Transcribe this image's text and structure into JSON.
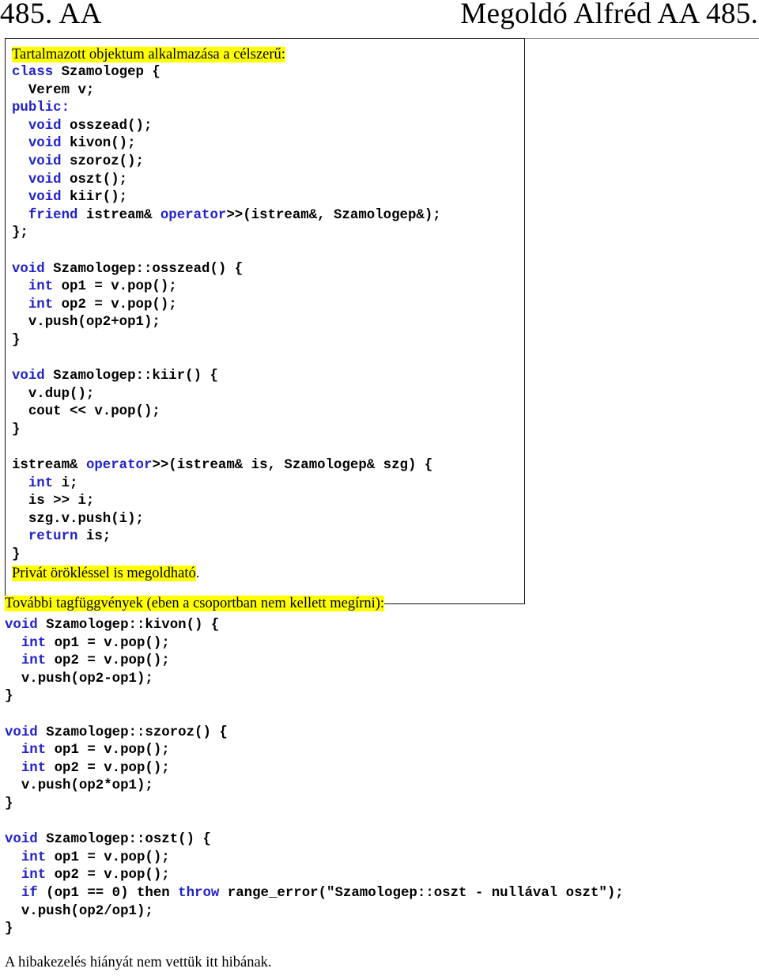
{
  "header": {
    "left_title": "485. AA",
    "right_title": "Megoldó Alfréd AA 485."
  },
  "table": {
    "main_cell": {
      "intro_note": "Tartalmazott objektum alkalmazása a célszerű:",
      "class_declaration": {
        "l1_kw": "class",
        "l1_rest": " Szamologep {",
        "l2": "  Verem v;",
        "l3_kw": "public:",
        "l4_kw": "  void",
        "l4_rest": " osszead();",
        "l5_kw": "  void",
        "l5_rest": " kivon();",
        "l6_kw": "  void",
        "l6_rest": " szoroz();",
        "l7_kw": "  void",
        "l7_rest": " oszt();",
        "l8_kw": "  void",
        "l8_rest": " kiir();",
        "l9_kw": "  friend",
        "l9_mid": " istream& ",
        "l9_kw2": "operator",
        "l9_rest": ">>(istream&, Szamologep&);",
        "l10": "};"
      },
      "osszead_def": {
        "l1_kw": "void",
        "l1_rest": " Szamologep::osszead() {",
        "l2_kw": "  int",
        "l2_rest": " op1 = v.pop();",
        "l3_kw": "  int",
        "l3_rest": " op2 = v.pop();",
        "l4": "  v.push(op2+op1);",
        "l5": "}"
      },
      "kiir_def": {
        "l1_kw": "void",
        "l1_rest": " Szamologep::kiir() {",
        "l2": "  v.dup();",
        "l3": "  cout << v.pop();",
        "l4": "}"
      },
      "operator_def": {
        "l1_pre": "istream& ",
        "l1_kw": "operator",
        "l1_rest": ">>(istream& is, Szamologep& szg) {",
        "l2_kw": "  int",
        "l2_rest": " i;",
        "l3": "  is >> i;",
        "l4": "  szg.v.push(i);",
        "l5_kw": "  return",
        "l5_rest": " is;",
        "l6": "}"
      },
      "closing_note": "Privát örökléssel is megoldható",
      "closing_note_tail": "."
    },
    "side_cell": {
      "content": ""
    }
  },
  "lower_section": {
    "heading": "További tagfüggvények (eben a csoportban nem kellett megírni):",
    "kivon_def": {
      "l1_kw": "void",
      "l1_rest": " Szamologep::kivon() {",
      "l2_kw": "  int",
      "l2_rest": " op1 = v.pop();",
      "l3_kw": "  int",
      "l3_rest": " op2 = v.pop();",
      "l4": "  v.push(op2-op1);",
      "l5": "}"
    },
    "szoroz_def": {
      "l1_kw": "void",
      "l1_rest": " Szamologep::szoroz() {",
      "l2_kw": "  int",
      "l2_rest": " op1 = v.pop();",
      "l3_kw": "  int",
      "l3_rest": " op2 = v.pop();",
      "l4": "  v.push(op2*op1);",
      "l5": "}"
    },
    "oszt_def": {
      "l1_kw": "void",
      "l1_rest": " Szamologep::oszt() {",
      "l2_kw": "  int",
      "l2_rest": " op1 = v.pop();",
      "l3_kw": "  int",
      "l3_rest": " op2 = v.pop();",
      "l4_kw": "  if",
      "l4_mid": " (op1 == 0) then ",
      "l4_kw2": "throw",
      "l4_rest": " range_error(\"Szamologep::oszt - nullával oszt\");",
      "l5": "  v.push(op2/op1);",
      "l6": "}"
    },
    "footer_note": "A hibakezelés hiányát nem vettük itt hibának."
  },
  "colors": {
    "keyword_blue": "#2222cc",
    "highlight_yellow": "#ffff00",
    "text_black": "#000000",
    "table_border": "#111111"
  }
}
